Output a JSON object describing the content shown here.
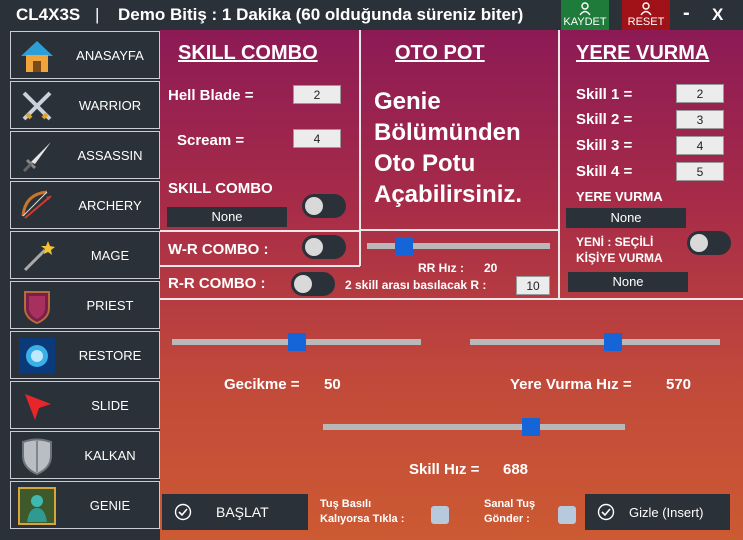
{
  "titlebar": {
    "app_name": "CL4X3S",
    "separator": "|",
    "demo_text": "Demo Bitiş : 1 Dakika (60 olduğunda süreniz biter)",
    "save_label": "KAYDET",
    "reset_label": "RESET",
    "minimize": "-",
    "close": "X"
  },
  "sidebar": {
    "items": [
      {
        "label": "ANASAYFA",
        "icon": "house-icon"
      },
      {
        "label": "WARRIOR",
        "icon": "crossed-swords-icon"
      },
      {
        "label": "ASSASSIN",
        "icon": "dagger-icon"
      },
      {
        "label": "ARCHERY",
        "icon": "bow-icon"
      },
      {
        "label": "MAGE",
        "icon": "magic-wand-icon"
      },
      {
        "label": "PRIEST",
        "icon": "shield-emblem-icon"
      },
      {
        "label": "RESTORE",
        "icon": "restore-aura-icon"
      },
      {
        "label": "SLIDE",
        "icon": "cursor-arrow-icon"
      },
      {
        "label": "KALKAN",
        "icon": "kite-shield-icon"
      },
      {
        "label": "GENIE",
        "icon": "genie-icon"
      }
    ]
  },
  "skill_combo": {
    "heading": "SKILL COMBO",
    "hell_blade_label": "Hell Blade =",
    "hell_blade_value": "2",
    "scream_label": "Scream =",
    "scream_value": "4",
    "combo_label": "SKILL COMBO",
    "combo_select": "None"
  },
  "oto_pot": {
    "heading": "OTO POT",
    "message_lines": [
      "Genie",
      "Bölümünden",
      "Oto Potu",
      "Açabilirsiniz."
    ]
  },
  "yere_vurma": {
    "heading": "YERE VURMA",
    "skills": [
      {
        "label": "Skill 1 =",
        "value": "2"
      },
      {
        "label": "Skill 2 =",
        "value": "3"
      },
      {
        "label": "Skill 3 =",
        "value": "4"
      },
      {
        "label": "Skill 4 =",
        "value": "5"
      }
    ],
    "section_label": "YERE VURMA",
    "select_value": "None",
    "selected_target_line1": "YENİ : SEÇİLİ",
    "selected_target_line2": "KİŞİYE VURMA",
    "target_select": "None"
  },
  "combos": {
    "wr_label": "W-R  COMBO :",
    "rr_label": "R-R  COMBO :"
  },
  "rr": {
    "speed_label": "RR Hız :",
    "speed_value": "20",
    "speed_level": 0.2,
    "between_label": "2 skill arası basılacak R :",
    "between_value": "10"
  },
  "sliders": {
    "delay_label": "Gecikme =",
    "delay_value": "50",
    "delay_level": 0.5,
    "ground_speed_label": "Yere Vurma Hız =",
    "ground_speed_value": "570",
    "ground_speed_level": 0.57,
    "skill_speed_label": "Skill Hız =",
    "skill_speed_value": "688",
    "skill_speed_level": 0.688
  },
  "bottom": {
    "start_label": "BAŞLAT",
    "hold_line1": "Tuş Basılı",
    "hold_line2": "Kalıyorsa Tıkla :",
    "virtual_line1": "Sanal Tuş",
    "virtual_line2": "Gönder :",
    "hide_label": "Gizle (Insert)"
  },
  "colors": {
    "save_green": "#1e7b3a",
    "reset_red": "#a01218",
    "slider_blue": "#1565d8",
    "panel_dark": "#2b3138"
  }
}
